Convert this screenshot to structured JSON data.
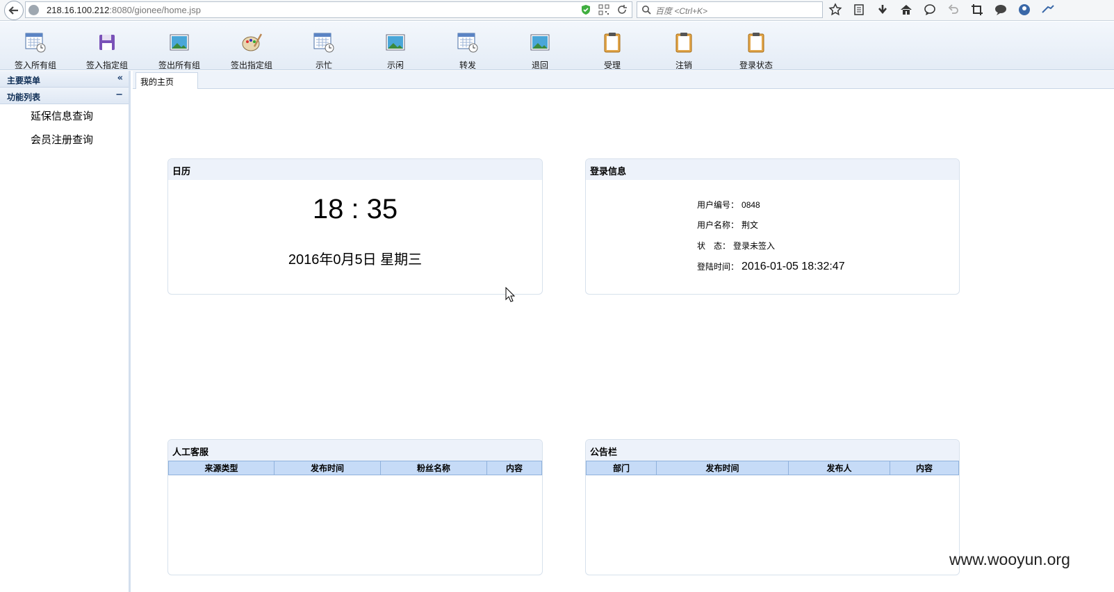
{
  "browser": {
    "url_host": "218.16.100.212",
    "url_rest": ":8080/gionee/home.jsp",
    "search_placeholder": "百度 <Ctrl+K>"
  },
  "toolbar": {
    "items": [
      {
        "label": "签入所有组",
        "icon": "calendar-clock-icon"
      },
      {
        "label": "签入指定组",
        "icon": "floppy-disk-icon"
      },
      {
        "label": "签出所有组",
        "icon": "picture-icon"
      },
      {
        "label": "签出指定组",
        "icon": "palette-icon"
      },
      {
        "label": "示忙",
        "icon": "calendar-clock-icon"
      },
      {
        "label": "示闲",
        "icon": "picture-icon"
      },
      {
        "label": "转发",
        "icon": "calendar-clock-icon"
      },
      {
        "label": "退回",
        "icon": "picture-icon"
      },
      {
        "label": "受理",
        "icon": "clipboard-icon"
      },
      {
        "label": "注销",
        "icon": "clipboard-icon"
      },
      {
        "label": "登录状态",
        "icon": "clipboard-icon"
      }
    ]
  },
  "sidebar": {
    "main_menu": "主要菜单",
    "function_list": "功能列表",
    "items": [
      "延保信息查询",
      "会员注册查询"
    ]
  },
  "tabs": {
    "home": "我的主页"
  },
  "calendar": {
    "title": "日历",
    "time": "18 : 35",
    "date": "2016年0月5日 星期三"
  },
  "login_info": {
    "title": "登录信息",
    "rows": [
      {
        "label": "用户编号：",
        "value": "0848"
      },
      {
        "label": "用户名称：",
        "value": "荆文"
      },
      {
        "label": "状　态：",
        "value": "登录未签入"
      },
      {
        "label": "登陆时间：",
        "value": "2016-01-05 18:32:47"
      }
    ]
  },
  "customer_service": {
    "title": "人工客服",
    "columns": [
      "来源类型",
      "发布时间",
      "粉丝名称",
      "内容"
    ]
  },
  "bulletin": {
    "title": "公告栏",
    "columns": [
      "部门",
      "发布时间",
      "发布人",
      "内容"
    ]
  },
  "watermark": "www.wooyun.org",
  "colors": {
    "accent": "#c6dbf7",
    "panel_header": "#edf2fa"
  }
}
